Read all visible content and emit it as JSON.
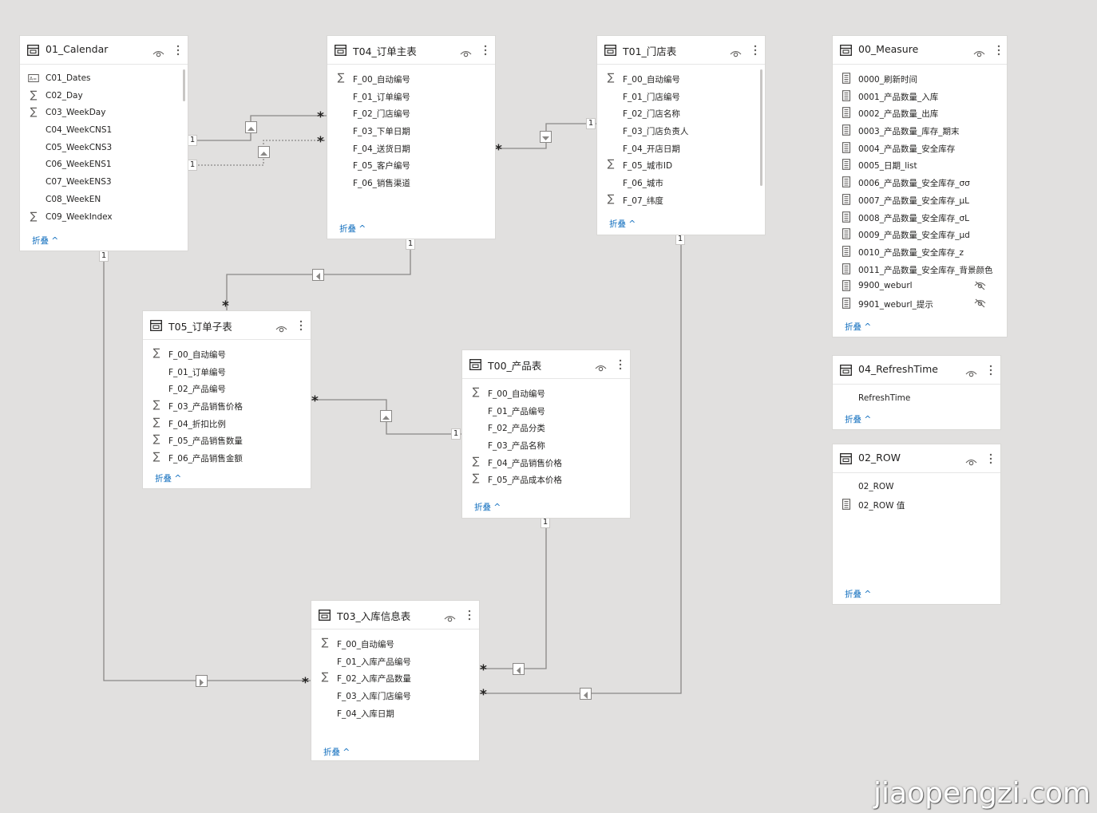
{
  "ui": {
    "collapse_label": "折叠 ^"
  },
  "tables": [
    {
      "id": "calendar",
      "title": "01_Calendar",
      "fields": [
        {
          "icon": "text-field-icon",
          "label": "C01_Dates"
        },
        {
          "icon": "sigma-icon",
          "label": "C02_Day"
        },
        {
          "icon": "sigma-icon",
          "label": "C03_WeekDay"
        },
        {
          "icon": "none",
          "label": "C04_WeekCNS1"
        },
        {
          "icon": "none",
          "label": "C05_WeekCNS3"
        },
        {
          "icon": "none",
          "label": "C06_WeekENS1"
        },
        {
          "icon": "none",
          "label": "C07_WeekENS3"
        },
        {
          "icon": "none",
          "label": "C08_WeekEN"
        },
        {
          "icon": "sigma-icon",
          "label": "C09_WeekIndex"
        }
      ]
    },
    {
      "id": "order-main",
      "title": "T04_订单主表",
      "fields": [
        {
          "icon": "sigma-icon",
          "label": "F_00_自动编号"
        },
        {
          "icon": "none",
          "label": "F_01_订单编号"
        },
        {
          "icon": "none",
          "label": "F_02_门店编号"
        },
        {
          "icon": "none",
          "label": "F_03_下单日期"
        },
        {
          "icon": "none",
          "label": "F_04_送货日期"
        },
        {
          "icon": "none",
          "label": "F_05_客户编号"
        },
        {
          "icon": "none",
          "label": "F_06_销售渠道"
        }
      ]
    },
    {
      "id": "store",
      "title": "T01_门店表",
      "fields": [
        {
          "icon": "sigma-icon",
          "label": "F_00_自动编号"
        },
        {
          "icon": "none",
          "label": "F_01_门店编号"
        },
        {
          "icon": "none",
          "label": "F_02_门店名称"
        },
        {
          "icon": "none",
          "label": "F_03_门店负责人"
        },
        {
          "icon": "none",
          "label": "F_04_开店日期"
        },
        {
          "icon": "sigma-icon",
          "label": "F_05_城市ID"
        },
        {
          "icon": "none",
          "label": "F_06_城市"
        },
        {
          "icon": "sigma-icon",
          "label": "F_07_纬度"
        }
      ]
    },
    {
      "id": "measure",
      "title": "00_Measure",
      "fields": [
        {
          "icon": "measure-icon",
          "label": "0000_刷新时间"
        },
        {
          "icon": "measure-icon",
          "label": "0001_产品数量_入库"
        },
        {
          "icon": "measure-icon",
          "label": "0002_产品数量_出库"
        },
        {
          "icon": "measure-icon",
          "label": "0003_产品数量_库存_期末"
        },
        {
          "icon": "measure-icon",
          "label": "0004_产品数量_安全库存"
        },
        {
          "icon": "measure-icon",
          "label": "0005_日期_list"
        },
        {
          "icon": "measure-icon",
          "label": "0006_产品数量_安全库存_σσ"
        },
        {
          "icon": "measure-icon",
          "label": "0007_产品数量_安全库存_μL"
        },
        {
          "icon": "measure-icon",
          "label": "0008_产品数量_安全库存_σL"
        },
        {
          "icon": "measure-icon",
          "label": "0009_产品数量_安全库存_μd"
        },
        {
          "icon": "measure-icon",
          "label": "0010_产品数量_安全库存_z"
        },
        {
          "icon": "measure-icon",
          "label": "0011_产品数量_安全库存_背景颜色"
        },
        {
          "icon": "measure-icon",
          "label": "9900_weburl",
          "hidden": true
        },
        {
          "icon": "measure-icon",
          "label": "9901_weburl_提示",
          "hidden": true
        }
      ]
    },
    {
      "id": "order-detail",
      "title": "T05_订单子表",
      "fields": [
        {
          "icon": "sigma-icon",
          "label": "F_00_自动编号"
        },
        {
          "icon": "none",
          "label": "F_01_订单编号"
        },
        {
          "icon": "none",
          "label": "F_02_产品编号"
        },
        {
          "icon": "sigma-icon",
          "label": "F_03_产品销售价格"
        },
        {
          "icon": "sigma-icon",
          "label": "F_04_折扣比例"
        },
        {
          "icon": "sigma-icon",
          "label": "F_05_产品销售数量"
        },
        {
          "icon": "sigma-icon",
          "label": "F_06_产品销售金额"
        }
      ]
    },
    {
      "id": "product",
      "title": "T00_产品表",
      "fields": [
        {
          "icon": "sigma-icon",
          "label": "F_00_自动编号"
        },
        {
          "icon": "none",
          "label": "F_01_产品编号"
        },
        {
          "icon": "none",
          "label": "F_02_产品分类"
        },
        {
          "icon": "none",
          "label": "F_03_产品名称"
        },
        {
          "icon": "sigma-icon",
          "label": "F_04_产品销售价格"
        },
        {
          "icon": "sigma-icon",
          "label": "F_05_产品成本价格"
        }
      ]
    },
    {
      "id": "inbound",
      "title": "T03_入库信息表",
      "fields": [
        {
          "icon": "sigma-icon",
          "label": "F_00_自动编号"
        },
        {
          "icon": "none",
          "label": "F_01_入库产品编号"
        },
        {
          "icon": "sigma-icon",
          "label": "F_02_入库产品数量"
        },
        {
          "icon": "none",
          "label": "F_03_入库门店编号"
        },
        {
          "icon": "none",
          "label": "F_04_入库日期"
        }
      ]
    },
    {
      "id": "refresh",
      "title": "04_RefreshTime",
      "fields": [
        {
          "icon": "none",
          "label": "RefreshTime"
        }
      ]
    },
    {
      "id": "row",
      "title": "02_ROW",
      "fields": [
        {
          "icon": "none",
          "label": "02_ROW"
        },
        {
          "icon": "measure-icon",
          "label": "02_ROW 值"
        }
      ]
    }
  ],
  "relationships": [
    {
      "from": "calendar",
      "to": "order-main",
      "one": "1",
      "many": "*",
      "active": true
    },
    {
      "from": "calendar",
      "to": "order-main",
      "one": "1",
      "many": "*",
      "active": false
    },
    {
      "from": "store",
      "to": "order-main",
      "one": "1",
      "many": "*",
      "active": true
    },
    {
      "from": "order-main",
      "to": "order-detail",
      "one": "1",
      "many": "*",
      "active": true
    },
    {
      "from": "product",
      "to": "order-detail",
      "one": "1",
      "many": "*",
      "active": true
    },
    {
      "from": "calendar",
      "to": "inbound",
      "one": "1",
      "many": "*",
      "active": true
    },
    {
      "from": "product",
      "to": "inbound",
      "one": "1",
      "many": "*",
      "active": true
    },
    {
      "from": "store",
      "to": "inbound",
      "one": "1",
      "many": "*",
      "active": true
    }
  ],
  "watermark": "jiaopengzi.com"
}
